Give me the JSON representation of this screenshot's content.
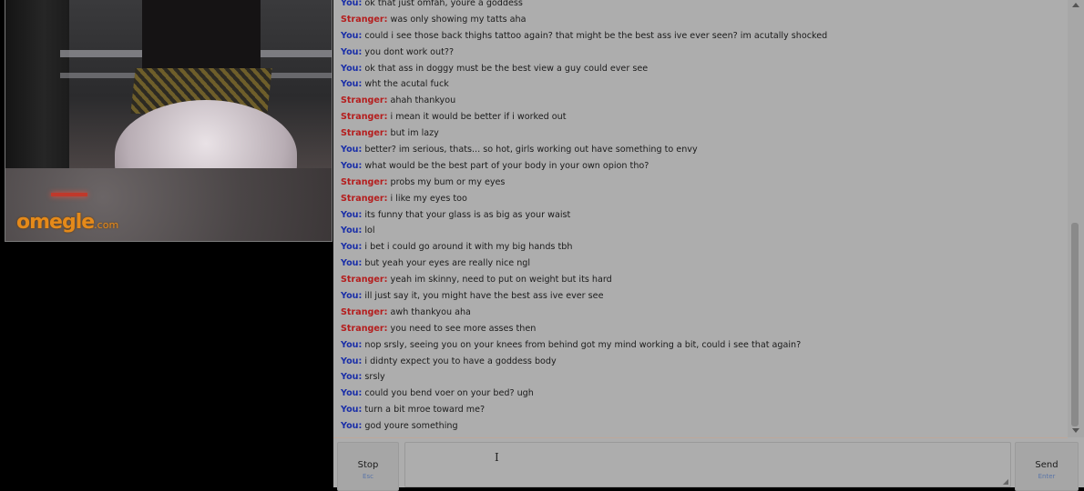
{
  "video": {
    "watermark_main": "omegle",
    "watermark_suffix": ".com"
  },
  "colors": {
    "you": "#1a2fa8",
    "stranger": "#b51d1d"
  },
  "chat": {
    "messages": [
      {
        "who": "You:",
        "role": "you",
        "text": "ok that just omfah, youre a goddess"
      },
      {
        "who": "Stranger:",
        "role": "stranger",
        "text": "was only showing my tatts aha"
      },
      {
        "who": "You:",
        "role": "you",
        "text": "could i see those back thighs tattoo again? that might be the best ass ive ever seen? im acutally shocked"
      },
      {
        "who": "You:",
        "role": "you",
        "text": "you dont work out??"
      },
      {
        "who": "You:",
        "role": "you",
        "text": "ok that ass in doggy must be the best view a guy could ever see"
      },
      {
        "who": "You:",
        "role": "you",
        "text": "wht the acutal fuck"
      },
      {
        "who": "Stranger:",
        "role": "stranger",
        "text": "ahah thankyou"
      },
      {
        "who": "Stranger:",
        "role": "stranger",
        "text": "i mean it would be better if i worked out"
      },
      {
        "who": "Stranger:",
        "role": "stranger",
        "text": "but im lazy"
      },
      {
        "who": "You:",
        "role": "you",
        "text": "better? im serious, thats... so hot, girls working out have something to envy"
      },
      {
        "who": "You:",
        "role": "you",
        "text": "what would be the best part of your body in your own opion tho?"
      },
      {
        "who": "Stranger:",
        "role": "stranger",
        "text": "probs my bum or my eyes"
      },
      {
        "who": "Stranger:",
        "role": "stranger",
        "text": "i like my eyes too"
      },
      {
        "who": "You:",
        "role": "you",
        "text": "its funny that your glass is as big as your waist"
      },
      {
        "who": "You:",
        "role": "you",
        "text": "lol"
      },
      {
        "who": "You:",
        "role": "you",
        "text": "i bet i could go around it with my big hands tbh"
      },
      {
        "who": "You:",
        "role": "you",
        "text": "but yeah your eyes are really nice ngl"
      },
      {
        "who": "Stranger:",
        "role": "stranger",
        "text": "yeah im skinny, need to put on weight but its hard"
      },
      {
        "who": "You:",
        "role": "you",
        "text": "ill just say it, you might have the best ass ive ever see"
      },
      {
        "who": "Stranger:",
        "role": "stranger",
        "text": "awh thankyou aha"
      },
      {
        "who": "Stranger:",
        "role": "stranger",
        "text": "you need to see more asses then"
      },
      {
        "who": "You:",
        "role": "you",
        "text": "nop srsly, seeing you on your knees from behind got my mind working a bit, could i see that again?"
      },
      {
        "who": "You:",
        "role": "you",
        "text": "i didnty expect you to have a goddess body"
      },
      {
        "who": "You:",
        "role": "you",
        "text": "srsly"
      },
      {
        "who": "You:",
        "role": "you",
        "text": "could you bend voer on your bed? ugh"
      },
      {
        "who": "You:",
        "role": "you",
        "text": "turn a bit mroe toward me?"
      },
      {
        "who": "You:",
        "role": "you",
        "text": "god youre something"
      }
    ]
  },
  "controls": {
    "stop_label": "Stop",
    "stop_key": "Esc",
    "send_label": "Send",
    "send_key": "Enter",
    "message_value": ""
  },
  "icons": {
    "text_cursor": "text-cursor-icon",
    "resize": "resize-handle-icon"
  }
}
